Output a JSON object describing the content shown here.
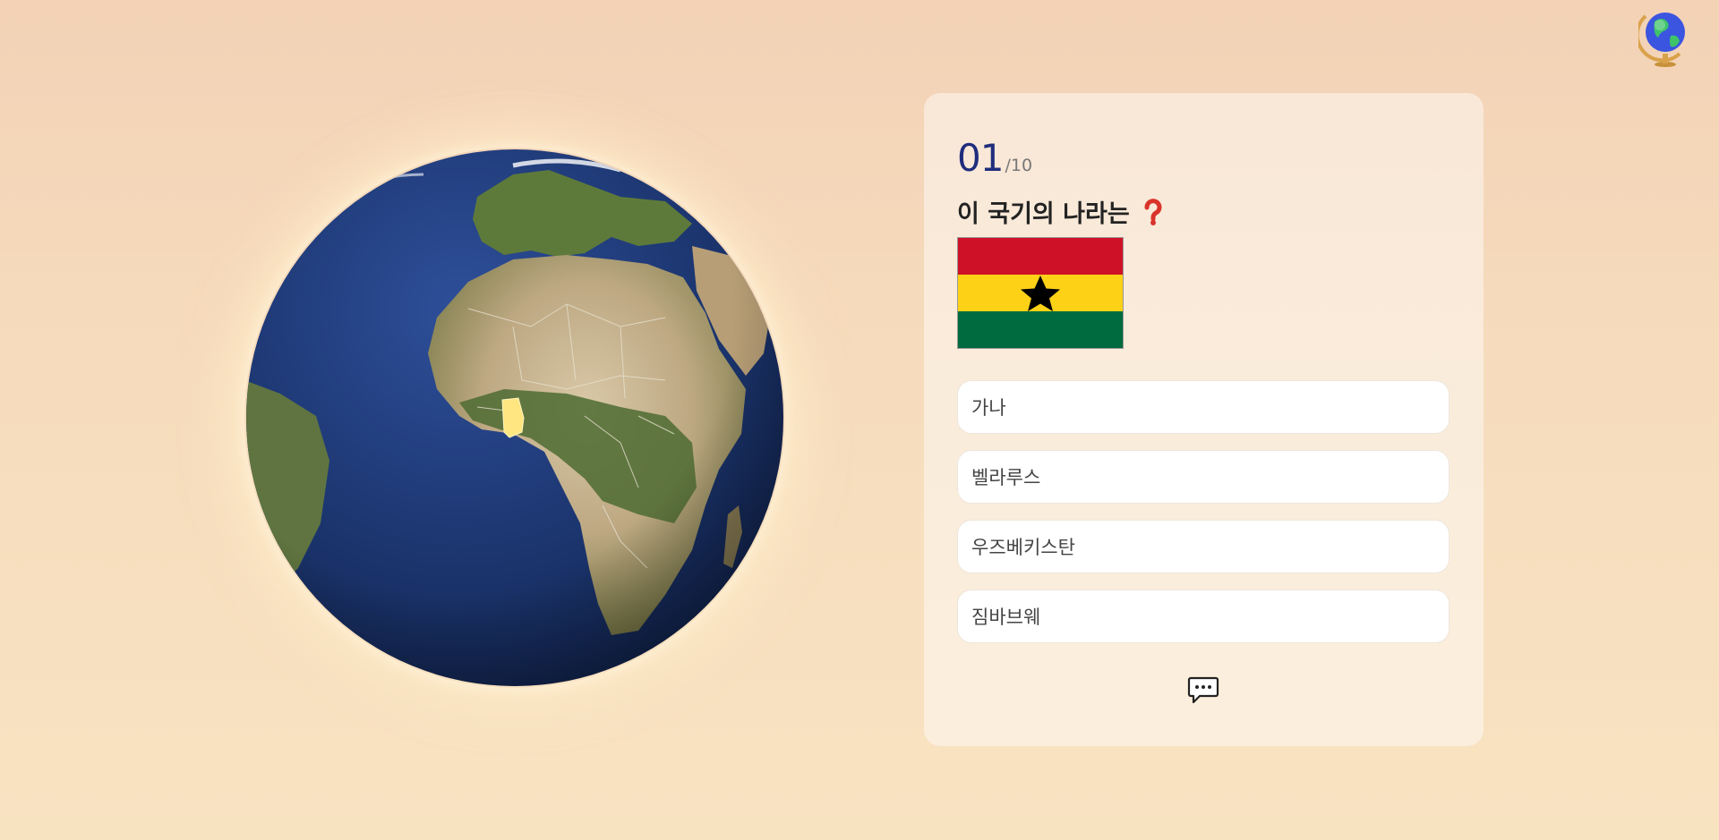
{
  "header": {
    "logo_icon": "globe-stand-icon"
  },
  "globe": {
    "highlighted_country": "Ghana",
    "highlight_color": "#ffe680",
    "ocean_color": "#1b3366"
  },
  "quiz": {
    "current": "01",
    "total": "/10",
    "question": "이 국기의 나라는",
    "question_icon": "question-mark-icon",
    "flag": {
      "colors": [
        "#ce1126",
        "#fcd116",
        "#006b3f"
      ],
      "star_color": "#000000"
    },
    "options": [
      {
        "label": "가나"
      },
      {
        "label": "벨라루스"
      },
      {
        "label": "우즈베키스탄"
      },
      {
        "label": "짐바브웨"
      }
    ],
    "hint_icon": "chat-bubble-icon"
  }
}
